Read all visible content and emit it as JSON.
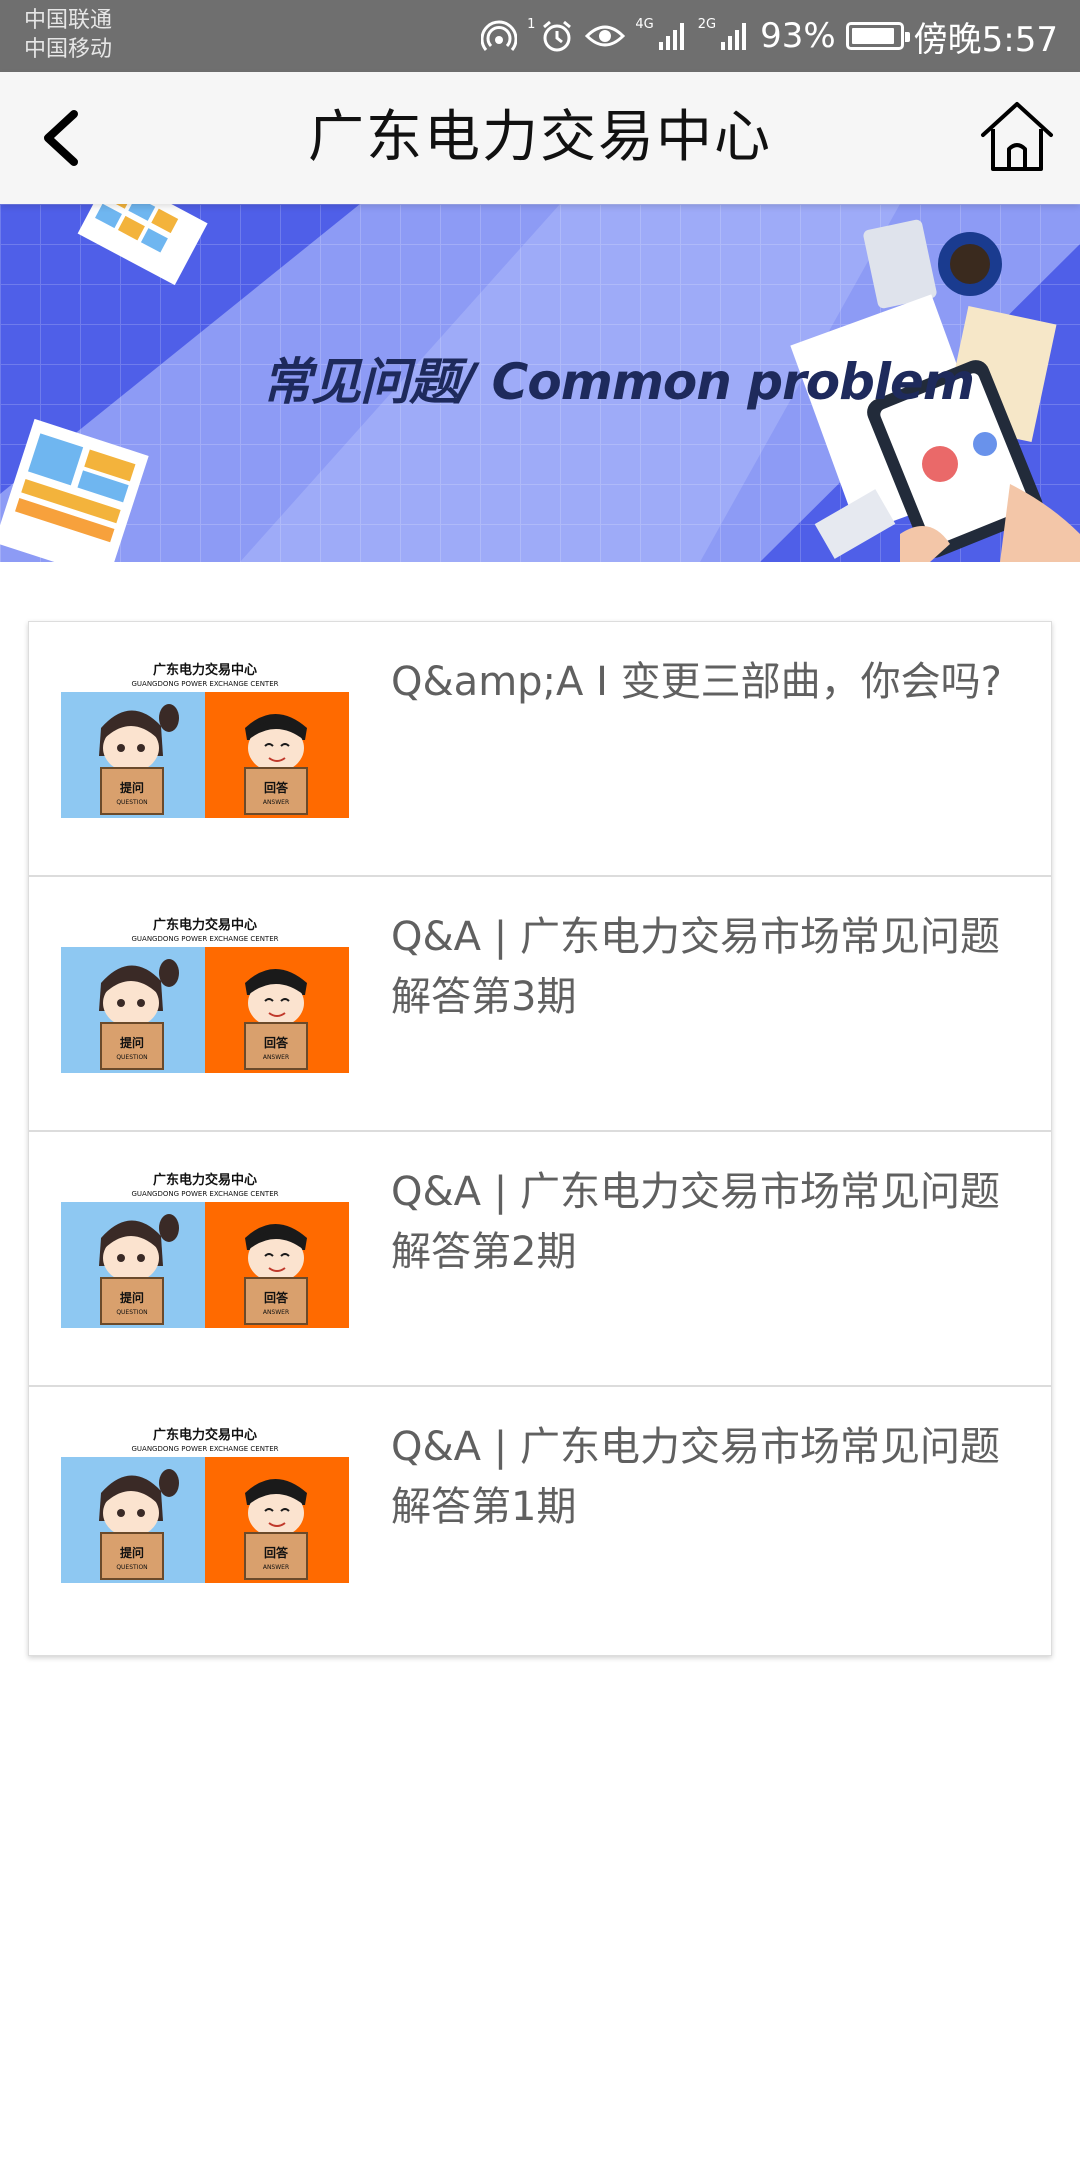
{
  "status_bar": {
    "carrier_1": "中国联通",
    "carrier_2": "中国移动",
    "net_4g": "4G",
    "net_2g": "2G",
    "sim_badge": "1",
    "battery": "93%",
    "battery_level": 0.93,
    "time": "傍晚5:57"
  },
  "header": {
    "title": "广东电力交易中心",
    "back_icon": "chevron-left-icon",
    "home_icon": "home-icon"
  },
  "banner": {
    "text": "常见问题/ Common problem"
  },
  "thumbnail": {
    "org_cn": "广东电力交易中心",
    "org_en": "GUANGDONG POWER EXCHANGE CENTER",
    "question_cn": "提问",
    "question_en": "QUESTION",
    "answer_cn": "回答",
    "answer_en": "ANSWER"
  },
  "items": [
    {
      "title": "Q&amp;A I 变更三部曲，你会吗?"
    },
    {
      "title": "Q&A | 广东电力交易市场常见问题解答第3期"
    },
    {
      "title": "Q&A | 广东电力交易市场常见问题解答第2期"
    },
    {
      "title": "Q&A | 广东电力交易市场常见问题解答第1期"
    }
  ],
  "colors": {
    "status_bar": "#6f6f6f",
    "header_bg": "#f6f6f6",
    "banner_blue": "#4f5fe8",
    "thumb_left": "#8ec8f2",
    "thumb_right": "#ff6a00",
    "title_text": "#606060"
  }
}
